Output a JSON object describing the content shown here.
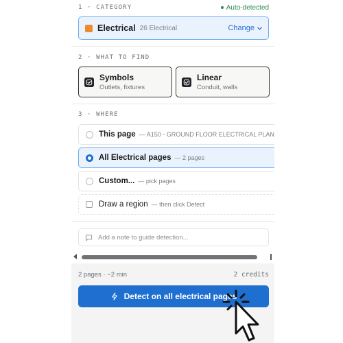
{
  "category": {
    "step_label": "1 · CATEGORY",
    "auto_detected": "Auto-detected",
    "name": "Electrical",
    "count": "26 Electrical",
    "swatch_color": "#ea8c2e",
    "change_label": "Change"
  },
  "find": {
    "step_label": "2 · WHAT TO FIND",
    "options": [
      {
        "title": "Symbols",
        "subtitle": "Outlets, fixtures",
        "checked": true
      },
      {
        "title": "Linear",
        "subtitle": "Conduit, walls",
        "checked": true
      }
    ]
  },
  "where": {
    "step_label": "3 · WHERE",
    "options": [
      {
        "label": "This page",
        "hint": "— A150 - GROUND FLOOR ELECTRICAL PLAN",
        "selected": false
      },
      {
        "label": "All Electrical pages",
        "hint": "— 2 pages",
        "selected": true
      },
      {
        "label": "Custom...",
        "hint": "— pick pages",
        "selected": false
      },
      {
        "label": "Draw a region",
        "hint": "— then click Detect",
        "selected": false
      }
    ]
  },
  "note": {
    "placeholder": "Add a note to guide detection..."
  },
  "footer": {
    "meta": "2 pages · ~2 min",
    "credits": "2 credits",
    "detect_label": "Detect on all electrical pages"
  },
  "colors": {
    "accent": "#1f6fd1",
    "success": "#2e8b57",
    "selected_bg": "#eaf3fd"
  }
}
